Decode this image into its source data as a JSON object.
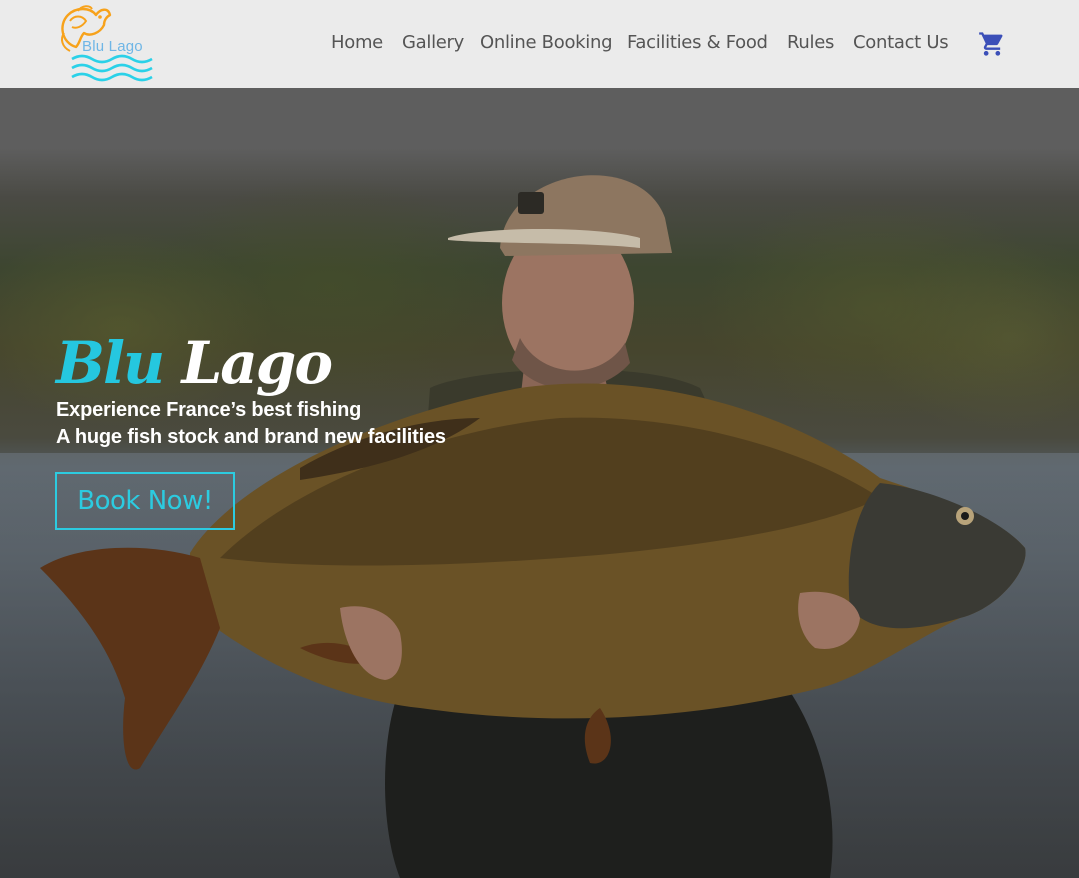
{
  "brand": {
    "logo_text": "Blu Lago"
  },
  "nav": {
    "items": [
      {
        "label": "Home"
      },
      {
        "label": "Gallery"
      },
      {
        "label": "Online Booking"
      },
      {
        "label": "Facilities & Food"
      },
      {
        "label": "Rules"
      },
      {
        "label": "Contact Us"
      }
    ],
    "cart_icon": "shopping-cart-icon"
  },
  "hero": {
    "title_part1": "Blu",
    "title_part2": "Lago",
    "subtitle_line1": "Experience France’s best fishing",
    "subtitle_line2": "A huge fish stock and brand new facilities",
    "cta_label": "Book Now!"
  },
  "colors": {
    "accent": "#2ccbe0",
    "header_bg": "#ebebeb",
    "nav_text": "#555555",
    "cart": "#3b4fb8",
    "logo_orange": "#f7a21b",
    "logo_waves": "#2ad1e8"
  }
}
